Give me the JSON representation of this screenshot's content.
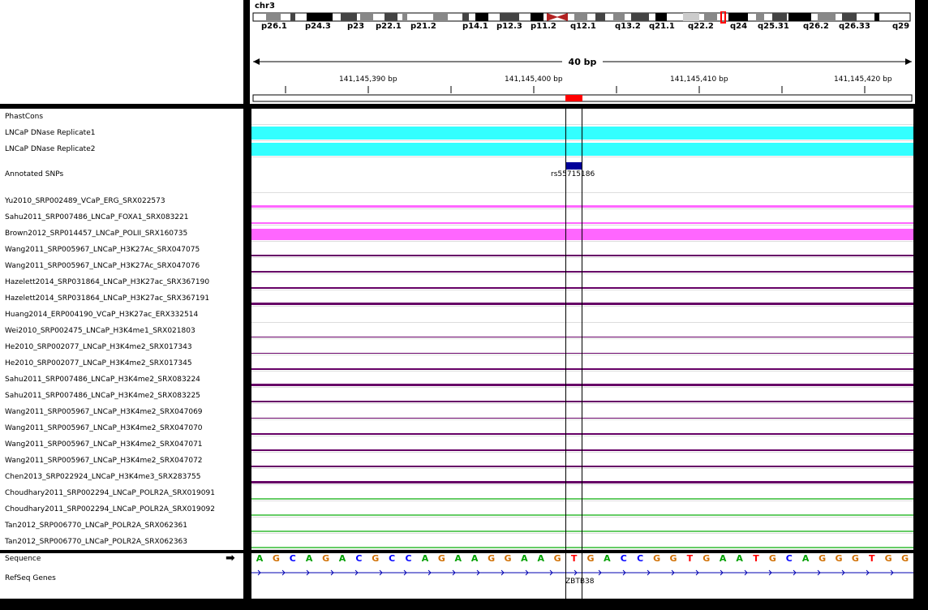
{
  "header": {
    "chromosome": "chr3",
    "bands": [
      "p26.1",
      "p24.3",
      "p23",
      "p22.1",
      "p21.2",
      "p14.1",
      "p12.3",
      "p11.2",
      "q12.1",
      "q13.2",
      "q21.1",
      "q22.2",
      "q24",
      "q25.31",
      "q26.2",
      "q26.33",
      "q29"
    ],
    "span": "40 bp",
    "ticks": [
      "141,145,390 bp",
      "141,145,400 bp",
      "141,145,410 bp",
      "141,145,420 bp"
    ]
  },
  "tracks": [
    {
      "name": "PhastCons",
      "color": "",
      "level": 0,
      "kind": "empty"
    },
    {
      "name": "LNCaP DNase Replicate1",
      "color": "#33ffff",
      "level": 1,
      "kind": "band"
    },
    {
      "name": "LNCaP DNase Replicate2",
      "color": "#33ffff",
      "level": 1,
      "kind": "band"
    },
    {
      "name": "Annotated SNPs",
      "color": "#000099",
      "level": 0,
      "kind": "snp"
    },
    {
      "name": "Yu2010_SRP002489_VCaP_ERG_SRX022573",
      "color": "#ff66ff",
      "level": 0.2,
      "kind": "signal"
    },
    {
      "name": "Sahu2011_SRP007486_LNCaP_FOXA1_SRX083221",
      "color": "#ff66ff",
      "level": 0.1,
      "kind": "signal"
    },
    {
      "name": "Brown2012_SRP014457_LNCaP_POLII_SRX160735",
      "color": "#ff66ff",
      "level": 0.9,
      "kind": "signal"
    },
    {
      "name": "Wang2011_SRP005967_LNCaP_H3K27Ac_SRX047075",
      "color": "#660066",
      "level": 0.1,
      "kind": "signal"
    },
    {
      "name": "Wang2011_SRP005967_LNCaP_H3K27Ac_SRX047076",
      "color": "#660066",
      "level": 0.1,
      "kind": "signal"
    },
    {
      "name": "Hazelett2014_SRP031864_LNCaP_H3K27ac_SRX367190",
      "color": "#660066",
      "level": 0.1,
      "kind": "signal"
    },
    {
      "name": "Hazelett2014_SRP031864_LNCaP_H3K27ac_SRX367191",
      "color": "#660066",
      "level": 0.2,
      "kind": "signal"
    },
    {
      "name": "Huang2014_ERP004190_VCaP_H3K27ac_ERX332514",
      "color": "#660066",
      "level": 0,
      "kind": "signal"
    },
    {
      "name": "Wei2010_SRP002475_LNCaP_H3K4me1_SRX021803",
      "color": "#660066",
      "level": 0.05,
      "kind": "signal"
    },
    {
      "name": "He2010_SRP002077_LNCaP_H3K4me2_SRX017343",
      "color": "#660066",
      "level": 0.05,
      "kind": "signal"
    },
    {
      "name": "He2010_SRP002077_LNCaP_H3K4me2_SRX017345",
      "color": "#660066",
      "level": 0.1,
      "kind": "signal"
    },
    {
      "name": "Sahu2011_SRP007486_LNCaP_H3K4me2_SRX083224",
      "color": "#660066",
      "level": 0.2,
      "kind": "signal"
    },
    {
      "name": "Sahu2011_SRP007486_LNCaP_H3K4me2_SRX083225",
      "color": "#660066",
      "level": 0.1,
      "kind": "signal"
    },
    {
      "name": "Wang2011_SRP005967_LNCaP_H3K4me2_SRX047069",
      "color": "#660066",
      "level": 0.05,
      "kind": "signal"
    },
    {
      "name": "Wang2011_SRP005967_LNCaP_H3K4me2_SRX047070",
      "color": "#660066",
      "level": 0.1,
      "kind": "signal"
    },
    {
      "name": "Wang2011_SRP005967_LNCaP_H3K4me2_SRX047071",
      "color": "#660066",
      "level": 0.1,
      "kind": "signal"
    },
    {
      "name": "Wang2011_SRP005967_LNCaP_H3K4me2_SRX047072",
      "color": "#660066",
      "level": 0.1,
      "kind": "signal"
    },
    {
      "name": "Chen2013_SRP022924_LNCaP_H3K4me3_SRX283755",
      "color": "#660066",
      "level": 0.2,
      "kind": "signal"
    },
    {
      "name": "Choudhary2011_SRP002294_LNCaP_POLR2A_SRX019091",
      "color": "#66cc66",
      "level": 0.1,
      "kind": "signal"
    },
    {
      "name": "Choudhary2011_SRP002294_LNCaP_POLR2A_SRX019092",
      "color": "#66cc66",
      "level": 0.1,
      "kind": "signal"
    },
    {
      "name": "Tan2012_SRP006770_LNCaP_POLR2A_SRX062361",
      "color": "#66cc66",
      "level": 0.1,
      "kind": "signal"
    },
    {
      "name": "Tan2012_SRP006770_LNCaP_POLR2A_SRX062363",
      "color": "#66cc66",
      "level": 0.1,
      "kind": "signal"
    }
  ],
  "snp": {
    "label": "rs55715186"
  },
  "sequence": {
    "label": "Sequence",
    "bases": [
      "A",
      "G",
      "C",
      "A",
      "G",
      "A",
      "C",
      "G",
      "C",
      "C",
      "A",
      "G",
      "A",
      "A",
      "G",
      "G",
      "A",
      "A",
      "G",
      "T",
      "G",
      "A",
      "C",
      "C",
      "G",
      "G",
      "T",
      "G",
      "A",
      "A",
      "T",
      "G",
      "C",
      "A",
      "G",
      "G",
      "G",
      "T",
      "G",
      "G"
    ],
    "colors": {
      "A": "#00a000",
      "C": "#0000ff",
      "G": "#d17105",
      "T": "#ff0000"
    }
  },
  "genes": {
    "label": "RefSeq Genes",
    "gene": "ZBTB38",
    "color": "#0000b2"
  }
}
